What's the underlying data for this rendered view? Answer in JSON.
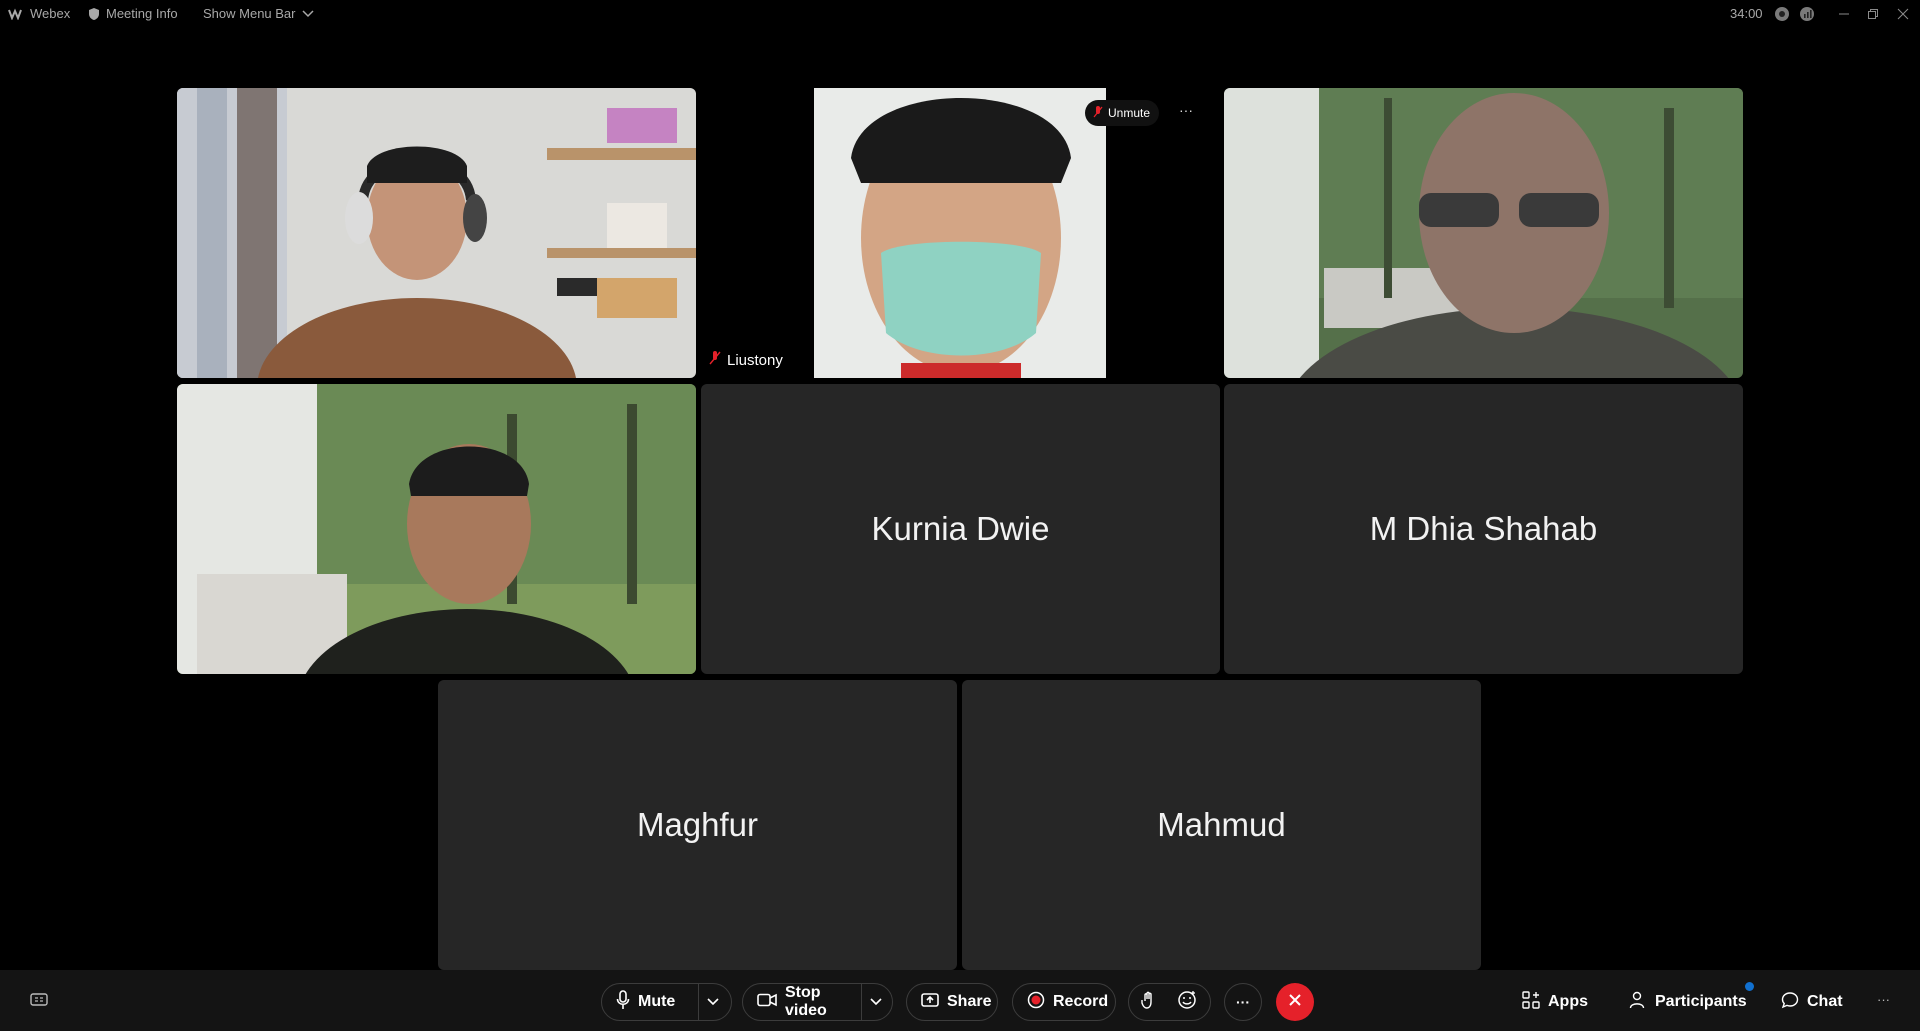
{
  "topbar": {
    "app_name": "Webex",
    "meeting_info": "Meeting Info",
    "show_menu_bar": "Show Menu Bar",
    "timer": "34:00"
  },
  "tiles": {
    "liustony": {
      "name": "Liustony",
      "unmute_label": "Unmute",
      "more_label": "···"
    },
    "kurnia": {
      "name": "Kurnia Dwie"
    },
    "dhia": {
      "name": "M Dhia Shahab"
    },
    "maghfur": {
      "name": "Maghfur"
    },
    "mahmud": {
      "name": "Mahmud"
    }
  },
  "controls": {
    "mute": "Mute",
    "stop_video": "Stop video",
    "share": "Share",
    "record": "Record",
    "more": "···",
    "apps": "Apps",
    "participants": "Participants",
    "chat": "Chat",
    "overflow": "···"
  },
  "colors": {
    "end_call": "#e5212a",
    "record_dot": "#e5212a",
    "notification_dot": "#1170cf"
  }
}
